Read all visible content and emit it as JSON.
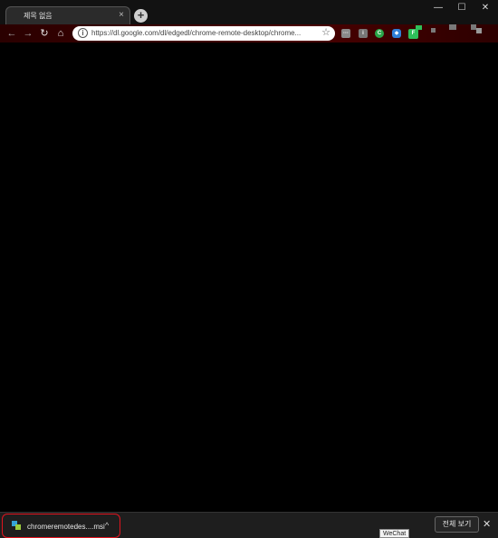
{
  "tab": {
    "title": "제목 없음",
    "close_glyph": "×"
  },
  "window": {
    "new_tab_glyph": "+",
    "minimize_glyph": "—",
    "maximize_glyph": "☐",
    "close_glyph": "✕"
  },
  "toolbar": {
    "back_glyph": "←",
    "forward_glyph": "→",
    "reload_glyph": "↻",
    "home_glyph": "⌂",
    "url": "https://dl.google.com/dl/edgedl/chrome-remote-desktop/chrome...",
    "info_glyph": "i",
    "bookmark_glyph": "☆"
  },
  "extensions": [
    {
      "name": "extension-1-icon",
      "glyph": "···"
    },
    {
      "name": "extension-2-icon",
      "glyph": "i"
    },
    {
      "name": "extension-3-icon",
      "glyph": "C"
    },
    {
      "name": "extension-4-icon",
      "glyph": "◆"
    },
    {
      "name": "extension-5-icon",
      "glyph": "F"
    }
  ],
  "download_shelf": {
    "item_name": "chromeremotedes....msi",
    "item_chevron": "^",
    "show_all_label": "전체 보기",
    "close_glyph": "✕",
    "tooltip": "WeChat"
  },
  "colors": {
    "toolbar_accent": "#4a0000",
    "highlight": "#e0141e"
  }
}
